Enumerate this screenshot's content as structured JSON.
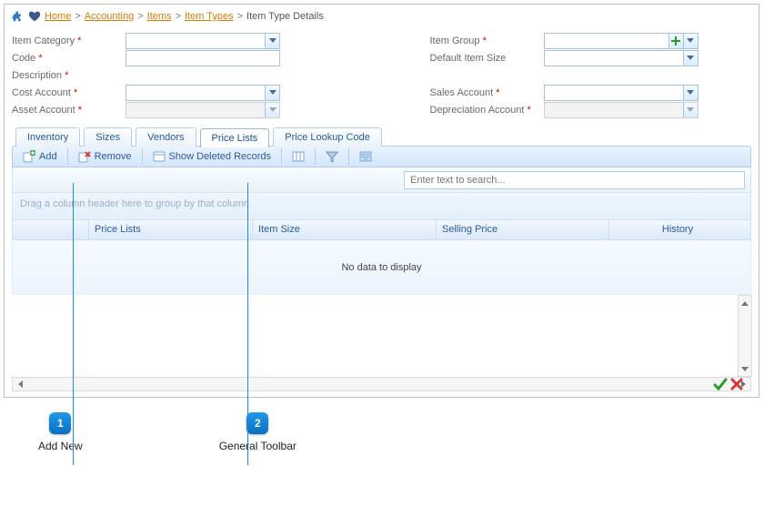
{
  "breadcrumb": {
    "links": [
      "Home",
      "Accounting",
      "Items",
      "Item Types"
    ],
    "current": "Item Type Details"
  },
  "form": {
    "left": {
      "item_category": "Item Category",
      "code": "Code",
      "description": "Description",
      "cost_account": "Cost Account",
      "asset_account": "Asset Account"
    },
    "right": {
      "item_group": "Item Group",
      "default_item_size": "Default Item Size",
      "sales_account": "Sales Account",
      "dep_account": "Depreciation Account"
    }
  },
  "tabs": {
    "inventory": "Inventory",
    "sizes": "Sizes",
    "vendors": "Vendors",
    "price_lists": "Price Lists",
    "lookup": "Price Lookup Code"
  },
  "toolbar": {
    "add": "Add",
    "remove": "Remove",
    "show_deleted": "Show Deleted Records"
  },
  "search": {
    "placeholder": "Enter text to search..."
  },
  "grid": {
    "group_hint": "Drag a column header here to group by that column",
    "cols": {
      "c2": "Price Lists",
      "c3": "Item Size",
      "c4": "Selling Price",
      "c5": "History"
    },
    "empty": "No data to display"
  },
  "callouts": {
    "1": {
      "num": "1",
      "label": "Add New"
    },
    "2": {
      "num": "2",
      "label": "General Toolbar"
    }
  }
}
